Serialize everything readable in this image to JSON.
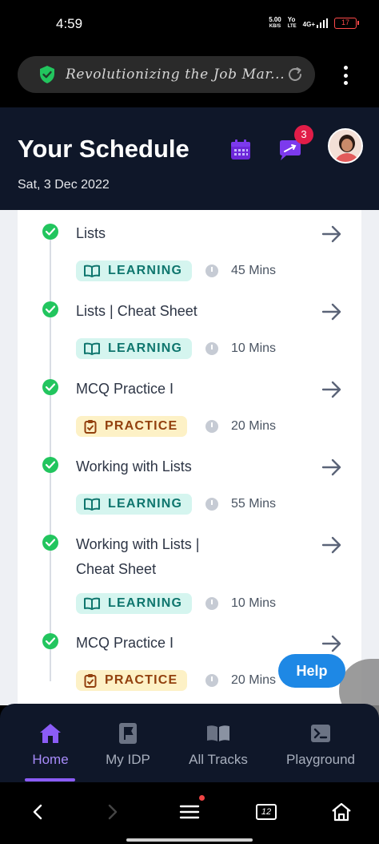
{
  "status_bar": {
    "time": "4:59",
    "net_speed": "5.00",
    "net_unit": "KB/S",
    "sim1": "Yo",
    "sim1_sub": "LTE",
    "sim2": "4G+",
    "battery": "17"
  },
  "browser": {
    "url_text": "Revolutionizing the Job Mar..."
  },
  "header": {
    "title": "Your Schedule",
    "date": "Sat, 3 Dec 2022",
    "notification_count": "3",
    "accent_color": "#7c3aed"
  },
  "schedule": {
    "items": [
      {
        "title": "Lists",
        "type": "LEARNING",
        "duration": "45 Mins"
      },
      {
        "title": "Lists | Cheat Sheet",
        "type": "LEARNING",
        "duration": "10 Mins"
      },
      {
        "title": "MCQ Practice I",
        "type": "PRACTICE",
        "duration": "20 Mins"
      },
      {
        "title": "Working with Lists",
        "type": "LEARNING",
        "duration": "55 Mins"
      },
      {
        "title": "Working with Lists | Cheat Sheet",
        "type": "LEARNING",
        "duration": "10 Mins"
      },
      {
        "title": "MCQ Practice I",
        "type": "PRACTICE",
        "duration": "20 Mins"
      }
    ]
  },
  "help": {
    "label": "Help"
  },
  "bottom_nav": {
    "items": [
      {
        "label": "Home",
        "icon": "home-icon",
        "active": true
      },
      {
        "label": "My IDP",
        "icon": "flag-icon",
        "active": false
      },
      {
        "label": "All Tracks",
        "icon": "book-icon",
        "active": false
      },
      {
        "label": "Playground",
        "icon": "terminal-icon",
        "active": false
      }
    ]
  },
  "system_nav": {
    "tabs_count": "12"
  }
}
